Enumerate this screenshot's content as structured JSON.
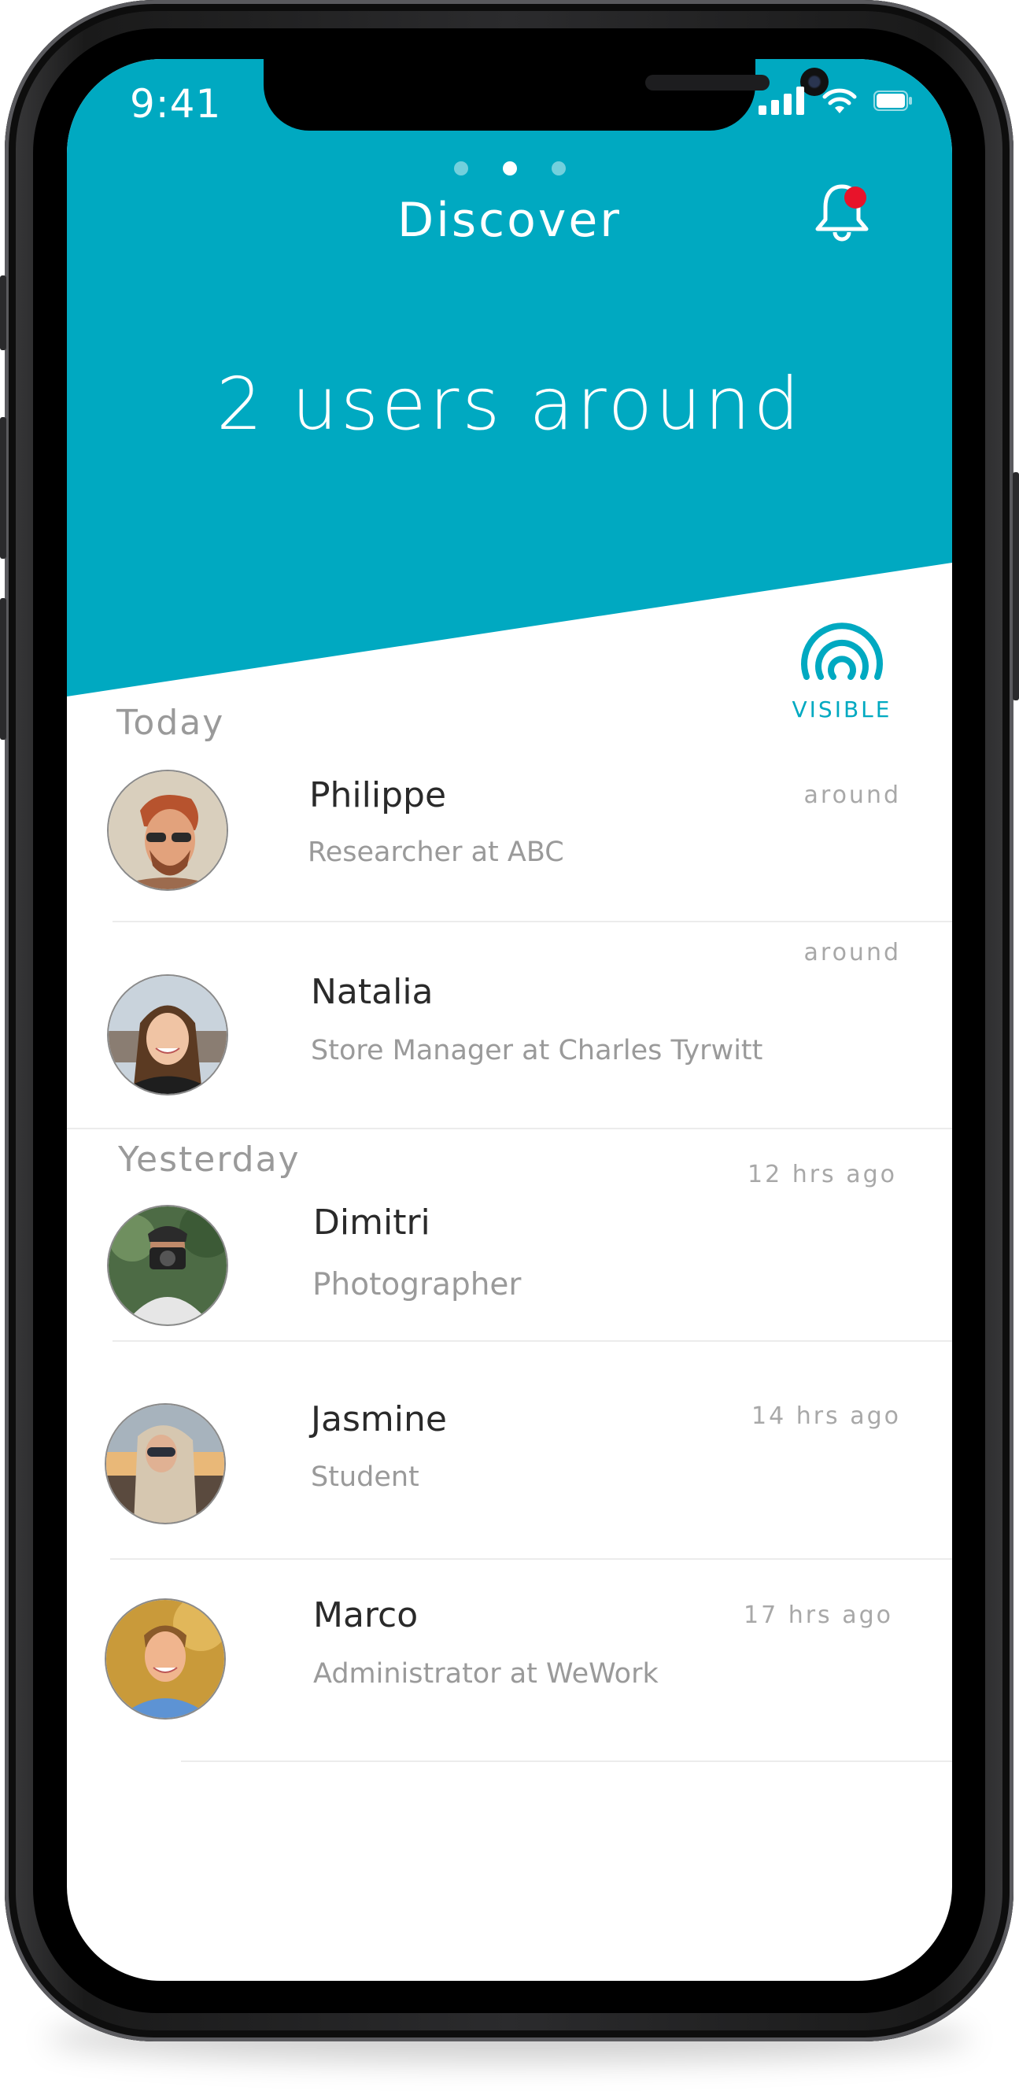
{
  "status_bar": {
    "time": "9:41"
  },
  "header": {
    "title": "Discover",
    "headline": "2 users around",
    "page_dots": 3,
    "active_dot": 1,
    "visibility_label": "VISIBLE"
  },
  "colors": {
    "accent": "#00a9c1",
    "notification": "#e8132a"
  },
  "sections": [
    {
      "label": "Today"
    },
    {
      "label": "Yesterday"
    }
  ],
  "users": [
    {
      "name": "Philippe",
      "role": "Researcher at ABC",
      "time": "around",
      "avatar_icon": "bearded-man-sunglasses-avatar"
    },
    {
      "name": "Natalia",
      "role": "Store Manager at Charles Tyrwitt",
      "time": "around",
      "avatar_icon": "smiling-woman-avatar"
    },
    {
      "name": "Dimitri",
      "role": "Photographer",
      "time": "12 hrs ago",
      "avatar_icon": "man-with-camera-avatar"
    },
    {
      "name": "Jasmine",
      "role": "Student",
      "time": "14 hrs ago",
      "avatar_icon": "woman-sunset-avatar"
    },
    {
      "name": "Marco",
      "role": "Administrator at WeWork",
      "time": "17 hrs ago",
      "avatar_icon": "smiling-man-avatar"
    }
  ]
}
